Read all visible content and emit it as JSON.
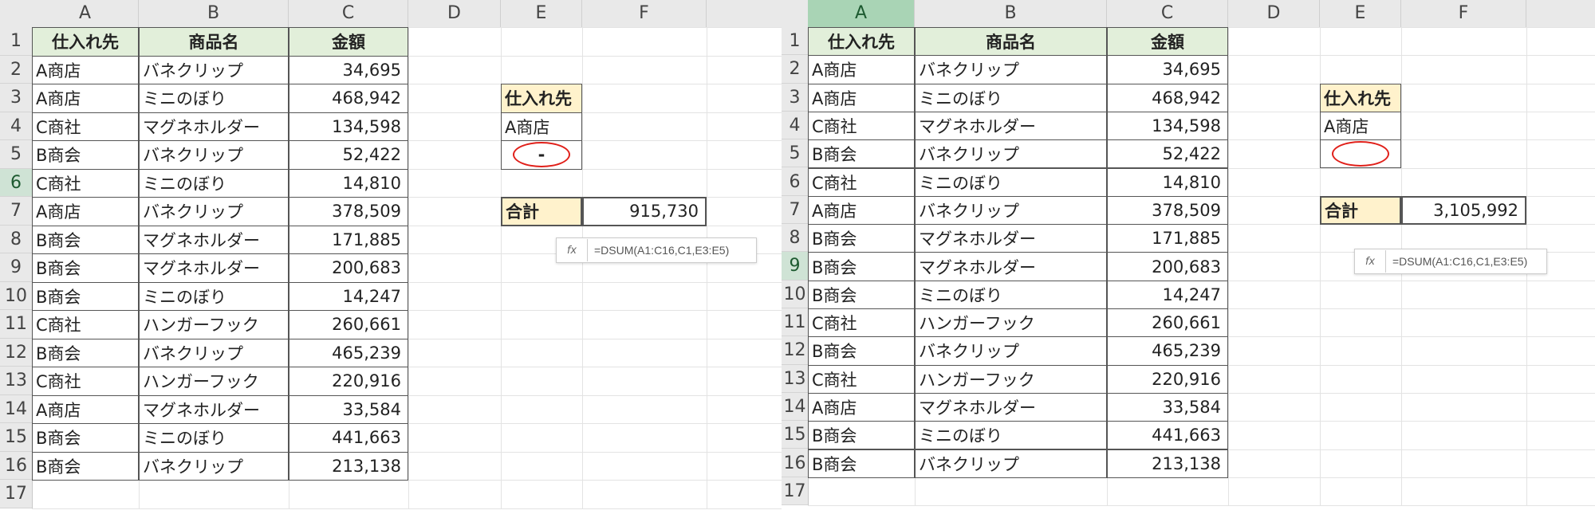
{
  "columns": [
    "A",
    "B",
    "C",
    "D",
    "E",
    "F"
  ],
  "rows": [
    "1",
    "2",
    "3",
    "4",
    "5",
    "6",
    "7",
    "8",
    "9",
    "10",
    "11",
    "12",
    "13",
    "14",
    "15",
    "16",
    "17"
  ],
  "headers": {
    "supplier": "仕入れ先",
    "product": "商品名",
    "amount": "金額"
  },
  "table": [
    {
      "supplier": "A商店",
      "product": "バネクリップ",
      "amount": "34,695"
    },
    {
      "supplier": "A商店",
      "product": "ミニのぼり",
      "amount": "468,942"
    },
    {
      "supplier": "C商社",
      "product": "マグネホルダー",
      "amount": "134,598"
    },
    {
      "supplier": "B商会",
      "product": "バネクリップ",
      "amount": "52,422"
    },
    {
      "supplier": "C商社",
      "product": "ミニのぼり",
      "amount": "14,810"
    },
    {
      "supplier": "A商店",
      "product": "バネクリップ",
      "amount": "378,509"
    },
    {
      "supplier": "B商会",
      "product": "マグネホルダー",
      "amount": "171,885"
    },
    {
      "supplier": "B商会",
      "product": "マグネホルダー",
      "amount": "200,683"
    },
    {
      "supplier": "B商会",
      "product": "ミニのぼり",
      "amount": "14,247"
    },
    {
      "supplier": "C商社",
      "product": "ハンガーフック",
      "amount": "260,661"
    },
    {
      "supplier": "B商会",
      "product": "バネクリップ",
      "amount": "465,239"
    },
    {
      "supplier": "C商社",
      "product": "ハンガーフック",
      "amount": "220,916"
    },
    {
      "supplier": "A商店",
      "product": "マグネホルダー",
      "amount": "33,584"
    },
    {
      "supplier": "B商会",
      "product": "ミニのぼり",
      "amount": "441,663"
    },
    {
      "supplier": "B商会",
      "product": "バネクリップ",
      "amount": "213,138"
    }
  ],
  "left": {
    "criteria_header": "仕入れ先",
    "criteria_value": "A商店",
    "criteria_extra": "-",
    "total_label": "合計",
    "total_value": "915,730",
    "formula": "=DSUM(A1:C16,C1,E3:E5)",
    "fx_label": "fx",
    "selected_row": "6"
  },
  "right": {
    "criteria_header": "仕入れ先",
    "criteria_value": "A商店",
    "criteria_extra": "",
    "total_label": "合計",
    "total_value": "3,105,992",
    "formula": "=DSUM(A1:C16,C1,E3:E5)",
    "fx_label": "fx",
    "selected_row": "9",
    "selected_col": "A"
  },
  "colors": {
    "header_green": "#e2efda",
    "criteria_yellow": "#fff2cc",
    "annotation_red": "#e0201a"
  }
}
